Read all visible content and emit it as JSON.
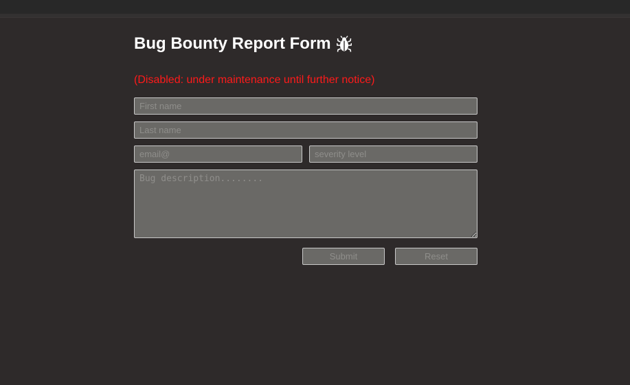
{
  "form": {
    "title": "Bug Bounty Report Form",
    "title_icon": "bug-icon",
    "notice": "(Disabled: under maintenance until further notice)",
    "notice_color": "#ff1a1a",
    "first_name_placeholder": "First name",
    "last_name_placeholder": "Last name",
    "email_placeholder": "email@",
    "severity_placeholder": "severity level",
    "description_placeholder": "Bug description........",
    "submit_label": "Submit",
    "reset_label": "Reset"
  },
  "colors": {
    "background": "#2e2a2a",
    "field_background": "#6a6966",
    "title_color": "#ffffff"
  }
}
